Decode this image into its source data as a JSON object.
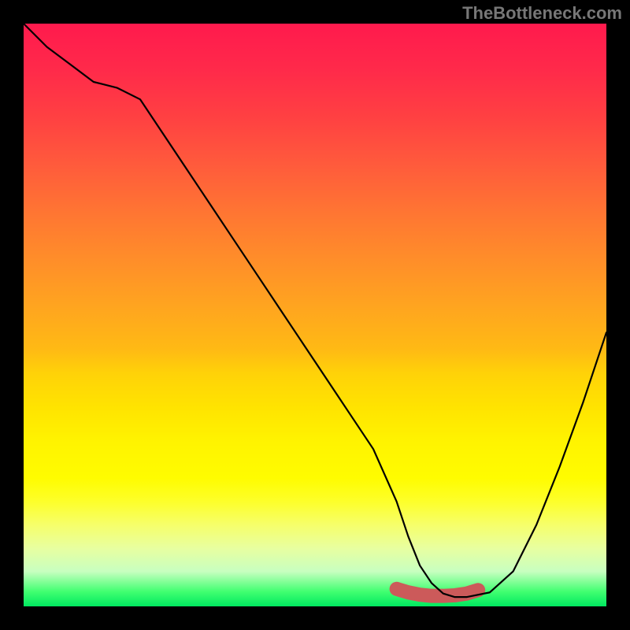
{
  "watermark": "TheBottleneck.com",
  "chart_data": {
    "type": "line",
    "title": "",
    "xlabel": "",
    "ylabel": "",
    "xlim": [
      0,
      100
    ],
    "ylim": [
      0,
      100
    ],
    "background_gradient": {
      "top": "#ff1a4d",
      "mid": "#ffe400",
      "bottom": "#00e860"
    },
    "series": [
      {
        "name": "bottleneck-curve",
        "color": "#000000",
        "x": [
          0,
          4,
          8,
          12,
          16,
          20,
          24,
          28,
          32,
          36,
          40,
          44,
          48,
          52,
          56,
          60,
          64,
          66,
          68,
          70,
          72,
          74,
          76,
          80,
          84,
          88,
          92,
          96,
          100
        ],
        "y": [
          100,
          96,
          93,
          90,
          89,
          87,
          81,
          75,
          69,
          63,
          57,
          51,
          45,
          39,
          33,
          27,
          18,
          12,
          7,
          4,
          2.2,
          1.6,
          1.6,
          2.4,
          6,
          14,
          24,
          35,
          47
        ]
      },
      {
        "name": "optimal-zone-highlight",
        "color": "#cc5a5a",
        "x": [
          64,
          66,
          68,
          70,
          72,
          74,
          76,
          78
        ],
        "y": [
          3.0,
          2.4,
          2.0,
          1.8,
          1.8,
          1.9,
          2.2,
          2.8
        ]
      }
    ],
    "annotations": []
  }
}
